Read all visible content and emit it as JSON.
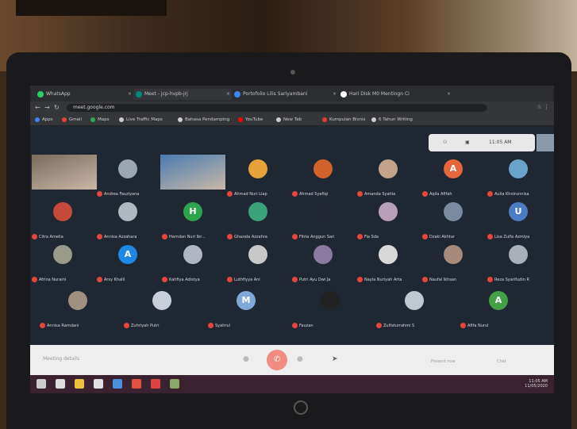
{
  "browser": {
    "tabs": [
      {
        "label": "WhatsApp",
        "color": "#25d366"
      },
      {
        "label": "Meet - jcp-hvpb-jrj",
        "color": "#00897b"
      },
      {
        "label": "Portofolio Lilis Sariyambani",
        "color": "#4285f4"
      },
      {
        "label": "Hari Disk M0 Mentingn Ci",
        "color": "#ffffff"
      }
    ],
    "url": "meet.google.com",
    "bookmarks": [
      {
        "label": "Apps",
        "color": "#4285f4"
      },
      {
        "label": "Gmail",
        "color": "#ea4335"
      },
      {
        "label": "Maps",
        "color": "#34a853"
      },
      {
        "label": "Live Traffic Maps",
        "color": "#cccccc"
      },
      {
        "label": "Bahasa Pendamping",
        "color": "#cccccc"
      },
      {
        "label": "YouTube",
        "color": "#ff0000"
      },
      {
        "label": "New Tab",
        "color": "#cccccc"
      },
      {
        "label": "Kumpulan Bisnis",
        "color": "#e53935"
      },
      {
        "label": "6 Tahun Writing",
        "color": "#cccccc"
      }
    ]
  },
  "meet": {
    "clock": "11:05 AM",
    "participants": [
      {
        "name": "",
        "initial": "",
        "color": "#7a6a5a",
        "video": true
      },
      {
        "name": "Andrea Fauziyana",
        "initial": "",
        "color": "#9aa6b2",
        "video": false
      },
      {
        "name": "",
        "initial": "",
        "color": "#4a7bb0",
        "video": true
      },
      {
        "name": "Ahmad Nuri Liap",
        "initial": "",
        "color": "#e8a23a",
        "video": false
      },
      {
        "name": "Ahmad Syafiqi",
        "initial": "",
        "color": "#d0622a",
        "video": false
      },
      {
        "name": "Amanda Syahla",
        "initial": "",
        "color": "#c3a38a",
        "video": false
      },
      {
        "name": "Aqila Afifah",
        "initial": "A",
        "color": "#e8663c",
        "video": false
      },
      {
        "name": "Aulia Khoirunnisa",
        "initial": "",
        "color": "#6aa3c9",
        "video": false
      },
      {
        "name": "Citra Amelia",
        "initial": "",
        "color": "#c64a3a",
        "video": false
      },
      {
        "name": "Annisa Azzahara",
        "initial": "",
        "color": "#b0b8c0",
        "video": false
      },
      {
        "name": "Hamdan Nuri Ibr...",
        "initial": "H",
        "color": "#2ea44f",
        "video": false
      },
      {
        "name": "Ghazala Azzahra",
        "initial": "",
        "color": "#3aa37a",
        "video": false
      },
      {
        "name": "Fitria Anggun Sari",
        "initial": "",
        "color": "#222833",
        "video": false
      },
      {
        "name": "Fia Sda",
        "initial": "",
        "color": "#b8a0b8",
        "video": false
      },
      {
        "name": "Dzaki Akhtar",
        "initial": "",
        "color": "#7a8aa0",
        "video": false
      },
      {
        "name": "Lisa Zulfa Azmiya",
        "initial": "U",
        "color": "#4b7cc4",
        "video": false
      },
      {
        "name": "Afrina Nuraini",
        "initial": "",
        "color": "#9a9a8a",
        "video": false
      },
      {
        "name": "Arsy Khalil",
        "initial": "A",
        "color": "#1e88e5",
        "video": false
      },
      {
        "name": "Kahfiya Adistya",
        "initial": "",
        "color": "#b0b6c0",
        "video": false
      },
      {
        "name": "Luthfiyya Ani",
        "initial": "",
        "color": "#c8c8c8",
        "video": false
      },
      {
        "name": "Putri Ayu Dwi Ja",
        "initial": "",
        "color": "#8a7aa0",
        "video": false
      },
      {
        "name": "Nayla Nuriyah Arta",
        "initial": "",
        "color": "#d8d8d8",
        "video": false
      },
      {
        "name": "Naufal Ikhsan",
        "initial": "",
        "color": "#a88a7a",
        "video": false
      },
      {
        "name": "Reza Syarifudin R",
        "initial": "",
        "color": "#aab0b8",
        "video": false
      },
      {
        "name": "Annisa Ramdani",
        "initial": "",
        "color": "#a09080",
        "video": false
      },
      {
        "name": "Zuhriyah Putri",
        "initial": "",
        "color": "#c8cfd8",
        "video": false
      },
      {
        "name": "Syahrul",
        "initial": "M",
        "color": "#7fa8d8",
        "video": false
      },
      {
        "name": "Fauzan",
        "initial": "",
        "color": "#222222",
        "video": false
      },
      {
        "name": "Zulfaturrahmi S",
        "initial": "",
        "color": "#c0c8d0",
        "video": false
      },
      {
        "name": "Afifa Nurul",
        "initial": "A",
        "color": "#43a047",
        "video": false
      }
    ]
  },
  "meetbar": {
    "meeting_details": "Meeting details",
    "hangup_icon": "hangup-icon",
    "present_label": "Present now",
    "chat_label": "Chat"
  },
  "taskbar": {
    "time": "11:05 AM",
    "date": "11/05/2020"
  }
}
